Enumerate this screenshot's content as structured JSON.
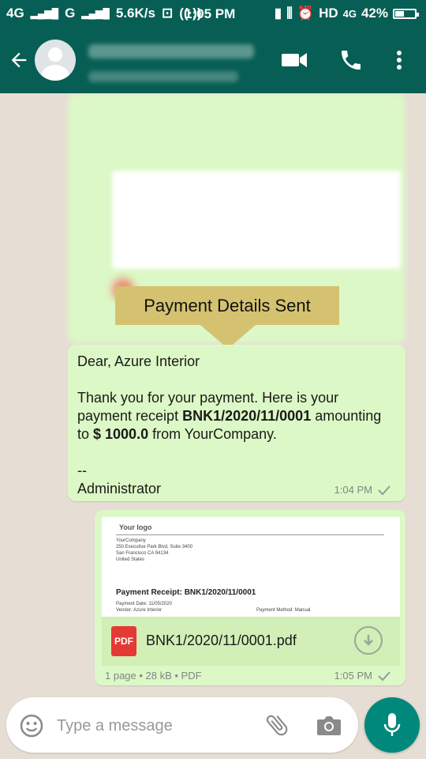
{
  "status_bar": {
    "network_left": "4G",
    "network_right": "G",
    "speed": "5.6K/s",
    "time": "1:05 PM",
    "hd": "HD",
    "lte": "4G",
    "battery": "42%",
    "battery_level": 0.42
  },
  "header": {
    "contact_name": "",
    "contact_status": ""
  },
  "callout": {
    "text": "Payment Details Sent"
  },
  "message1": {
    "greeting": "Dear, Azure Interior",
    "line1_pre": "Thank you for your payment. Here is your payment receipt ",
    "receipt_ref": "BNK1/2020/11/0001",
    "line1_mid": " amounting to ",
    "amount": "$ 1000.0",
    "line1_post": " from YourCompany.",
    "signature_sep": "--",
    "signature": "Administrator",
    "time": "1:04 PM"
  },
  "message2": {
    "preview": {
      "logo": "Your logo",
      "company": "YourCompany",
      "addr1": "250 Executive Park Blvd, Suite 3400",
      "addr2": "San Francisco CA 94134",
      "addr3": "United States",
      "title": "Payment Receipt: BNK1/2020/11/0001",
      "payment_date": "Payment Date: 11/05/2020",
      "vendor": "Vendor: Azure Interior",
      "method": "Payment Method: Manual"
    },
    "file_type_badge": "PDF",
    "file_name": "BNK1/2020/11/0001.pdf",
    "info": "1 page • 28 kB • PDF",
    "time": "1:05 PM"
  },
  "input_bar": {
    "placeholder": "Type a message"
  },
  "colors": {
    "header": "#075e54",
    "bubble": "#dcf8c6",
    "accent": "#00897b",
    "callout": "#d4c270"
  }
}
